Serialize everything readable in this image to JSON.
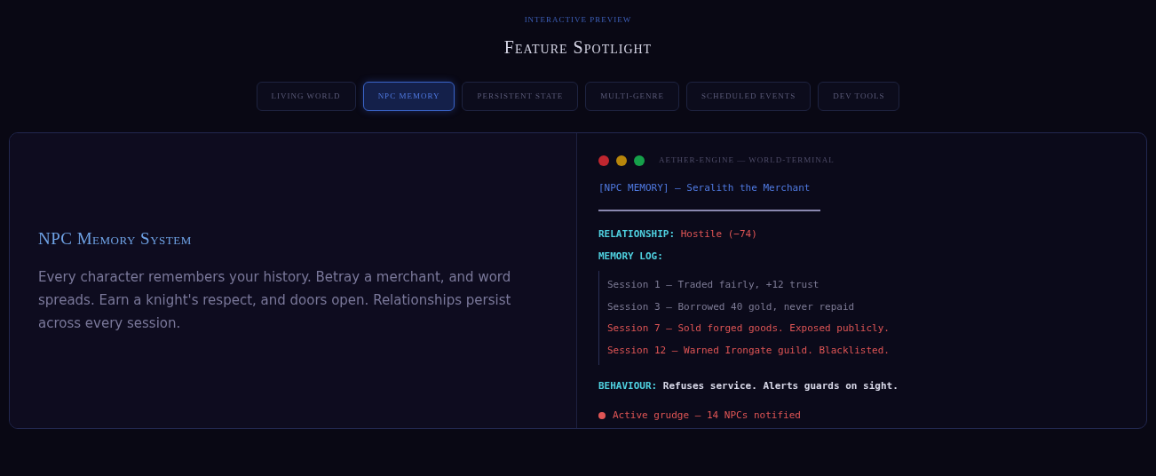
{
  "header": {
    "eyebrow": "INTERACTIVE PREVIEW",
    "title": "Feature Spotlight"
  },
  "tabs": [
    {
      "label": "LIVING WORLD",
      "selected": false
    },
    {
      "label": "NPC MEMORY",
      "selected": true
    },
    {
      "label": "PERSISTENT STATE",
      "selected": false
    },
    {
      "label": "MULTI-GENRE",
      "selected": false
    },
    {
      "label": "SCHEDULED EVENTS",
      "selected": false
    },
    {
      "label": "DEV TOOLS",
      "selected": false
    }
  ],
  "feature": {
    "title": "NPC Memory System",
    "description": "Every character remembers your history. Betray a merchant, and word spreads. Earn a knight's respect, and doors open. Relationships persist across every session."
  },
  "terminal": {
    "title": "AETHER-ENGINE — WORLD-TERMINAL",
    "heading": "[NPC MEMORY] — Seralith the Merchant",
    "relationship_label": "RELATIONSHIP:",
    "relationship_value": "Hostile (−74)",
    "memory_label": "MEMORY LOG:",
    "memory_log": [
      {
        "text": "Session 1 — Traded fairly, +12 trust",
        "kind": "neutral"
      },
      {
        "text": "Session 3 — Borrowed 40 gold, never repaid",
        "kind": "neutral"
      },
      {
        "text": "Session 7 — Sold forged goods. Exposed publicly.",
        "kind": "negative"
      },
      {
        "text": "Session 12 — Warned Irongate guild. Blacklisted.",
        "kind": "negative"
      }
    ],
    "behaviour_label": "BEHAVIOUR:",
    "behaviour_value": "Refuses service. Alerts guards on sight.",
    "status": {
      "text": "Active grudge — 14 NPCs notified",
      "color": "#e05555"
    }
  }
}
